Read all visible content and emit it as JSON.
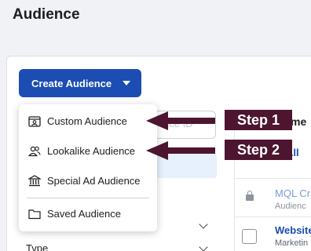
{
  "page": {
    "title": "Audience"
  },
  "toolbar": {
    "create_label": "Create Audience"
  },
  "search": {
    "placeholder": "nce ID"
  },
  "filters": {
    "type_label": "Type"
  },
  "table": {
    "name_header": "me",
    "select_all": "All",
    "rows": [
      {
        "name": "MQL Cr",
        "sub": "Audienc",
        "locked": true
      },
      {
        "name": "Website",
        "sub": "Marketin",
        "locked": false
      }
    ]
  },
  "dropdown": {
    "items": [
      {
        "label": "Custom Audience",
        "icon": "custom-audience-icon"
      },
      {
        "label": "Lookalike Audience",
        "icon": "lookalike-people-icon"
      },
      {
        "label": "Special Ad Audience",
        "icon": "bank-building-icon"
      },
      {
        "label": "Saved Audience",
        "icon": "folder-icon"
      }
    ]
  },
  "annotations": {
    "step1": "Step 1",
    "step2": "Step 2",
    "color": "#4d1530"
  },
  "colors": {
    "primary": "#1b4db3",
    "link": "#1b4db3"
  }
}
